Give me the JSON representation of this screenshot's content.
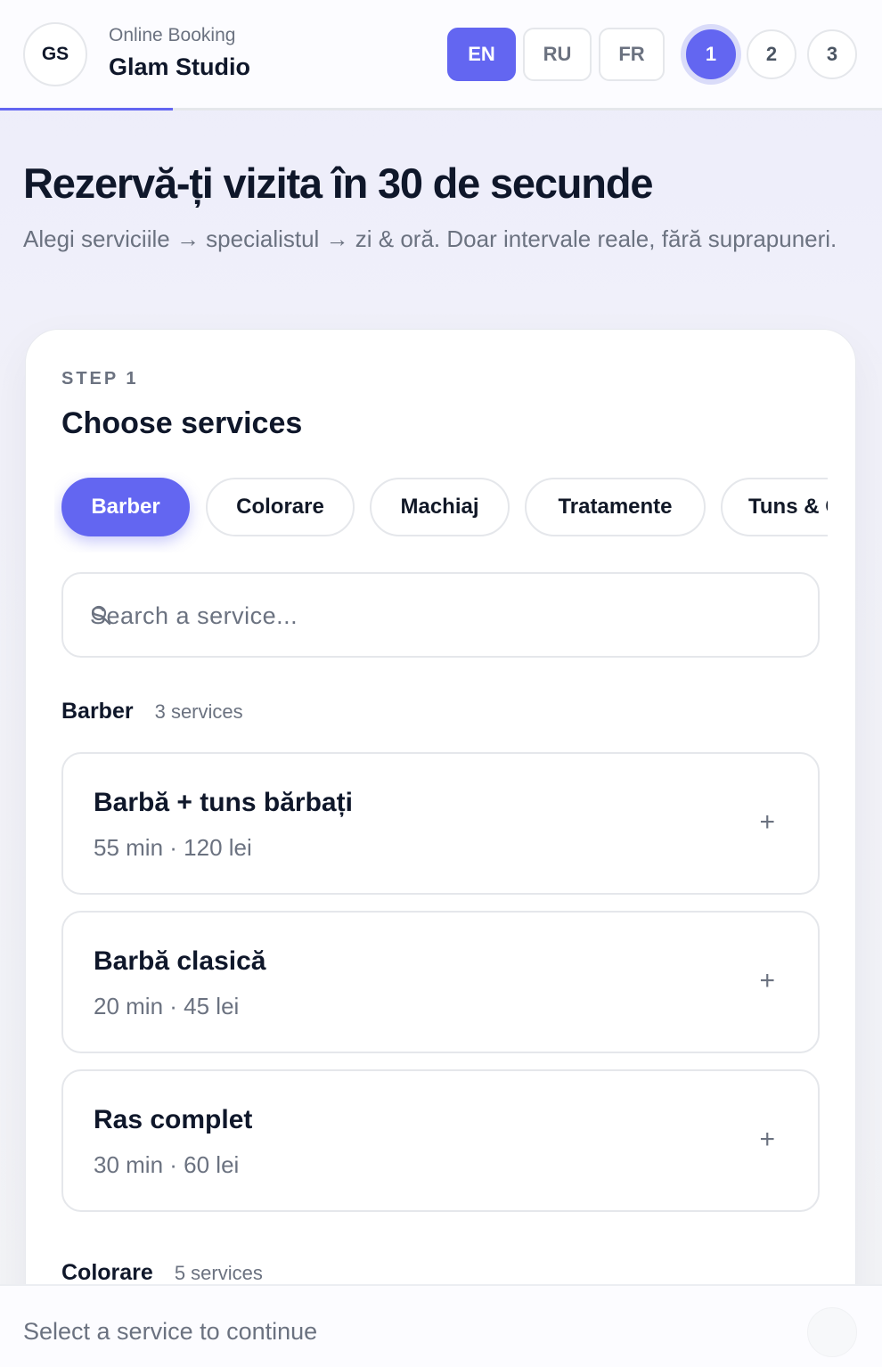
{
  "header": {
    "logo_initials": "GS",
    "subtitle": "Online Booking",
    "brand_name": "Glam Studio",
    "languages": [
      {
        "label": "EN",
        "active": true
      },
      {
        "label": "RU",
        "active": false
      },
      {
        "label": "FR",
        "active": false
      }
    ],
    "steps": [
      {
        "label": "1",
        "active": true
      },
      {
        "label": "2",
        "active": false
      },
      {
        "label": "3",
        "active": false
      }
    ]
  },
  "hero": {
    "title": "Rezervă-ți vizita în 30 de secunde",
    "subtitle": "Alegi serviciile → specialistul → zi & oră. Doar intervale reale, fără suprapuneri."
  },
  "card": {
    "step_label": "STEP 1",
    "title": "Choose services",
    "categories": [
      {
        "label": "Barber",
        "active": true
      },
      {
        "label": "Colorare",
        "active": false
      },
      {
        "label": "Machiaj",
        "active": false
      },
      {
        "label": "Tratamente",
        "active": false
      },
      {
        "label": "Tuns & Coafat",
        "active": false
      }
    ],
    "search": {
      "placeholder": "Search a service...",
      "value": ""
    },
    "groups": [
      {
        "name": "Barber",
        "count": "3 services",
        "services": [
          {
            "name": "Barbă + tuns bărbați",
            "meta": "55 min · 120 lei",
            "action": "+"
          },
          {
            "name": "Barbă clasică",
            "meta": "20 min · 45 lei",
            "action": "+"
          },
          {
            "name": "Ras complet",
            "meta": "30 min · 60 lei",
            "action": "+"
          }
        ]
      },
      {
        "name": "Colorare",
        "count": "5 services",
        "services": []
      }
    ]
  },
  "footer": {
    "status": "Select a service to continue"
  },
  "colors": {
    "accent": "#6366f1",
    "text": "#0f172a",
    "muted": "#6b7280",
    "border": "#e5e7eb"
  },
  "icons": {
    "search": "search-icon",
    "add": "plus-icon"
  }
}
